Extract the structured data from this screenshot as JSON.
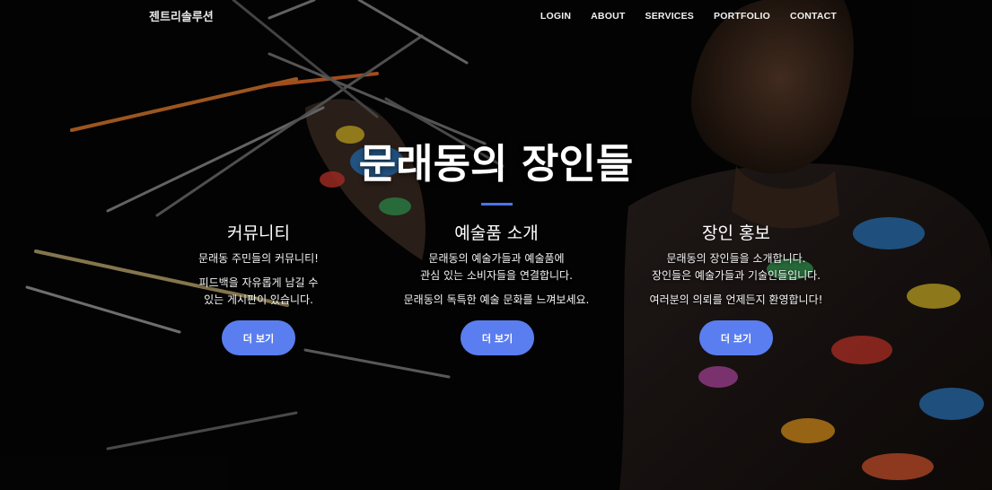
{
  "nav": {
    "brand": "젠트리솔루션",
    "items": [
      "LOGIN",
      "ABOUT",
      "SERVICES",
      "PORTFOLIO",
      "CONTACT"
    ]
  },
  "hero": {
    "title": "문래동의 장인들"
  },
  "columns": [
    {
      "heading": "커뮤니티",
      "p1": "문래동 주민들의 커뮤니티!",
      "p2a": "피드백을 자유롭게 남길 수",
      "p2b": "있는 게시판이 있습니다.",
      "button": "더 보기"
    },
    {
      "heading": "예술품 소개",
      "p1a": "문래동의 예술가들과 예술품에",
      "p1b": "관심 있는 소비자들을 연결합니다.",
      "p2": "문래동의 독특한 예술 문화를 느껴보세요.",
      "button": "더 보기"
    },
    {
      "heading": "장인 홍보",
      "p1a": "문래동의 장인들을 소개합니다.",
      "p1b": "장인들은 예술가들과 기술인들입니다.",
      "p2": "여러분의 의뢰를 언제든지 환영합니다!",
      "button": "더 보기"
    }
  ],
  "colors": {
    "accent": "#5a7ef0",
    "divider": "#4a74ec",
    "background": "#050505"
  }
}
